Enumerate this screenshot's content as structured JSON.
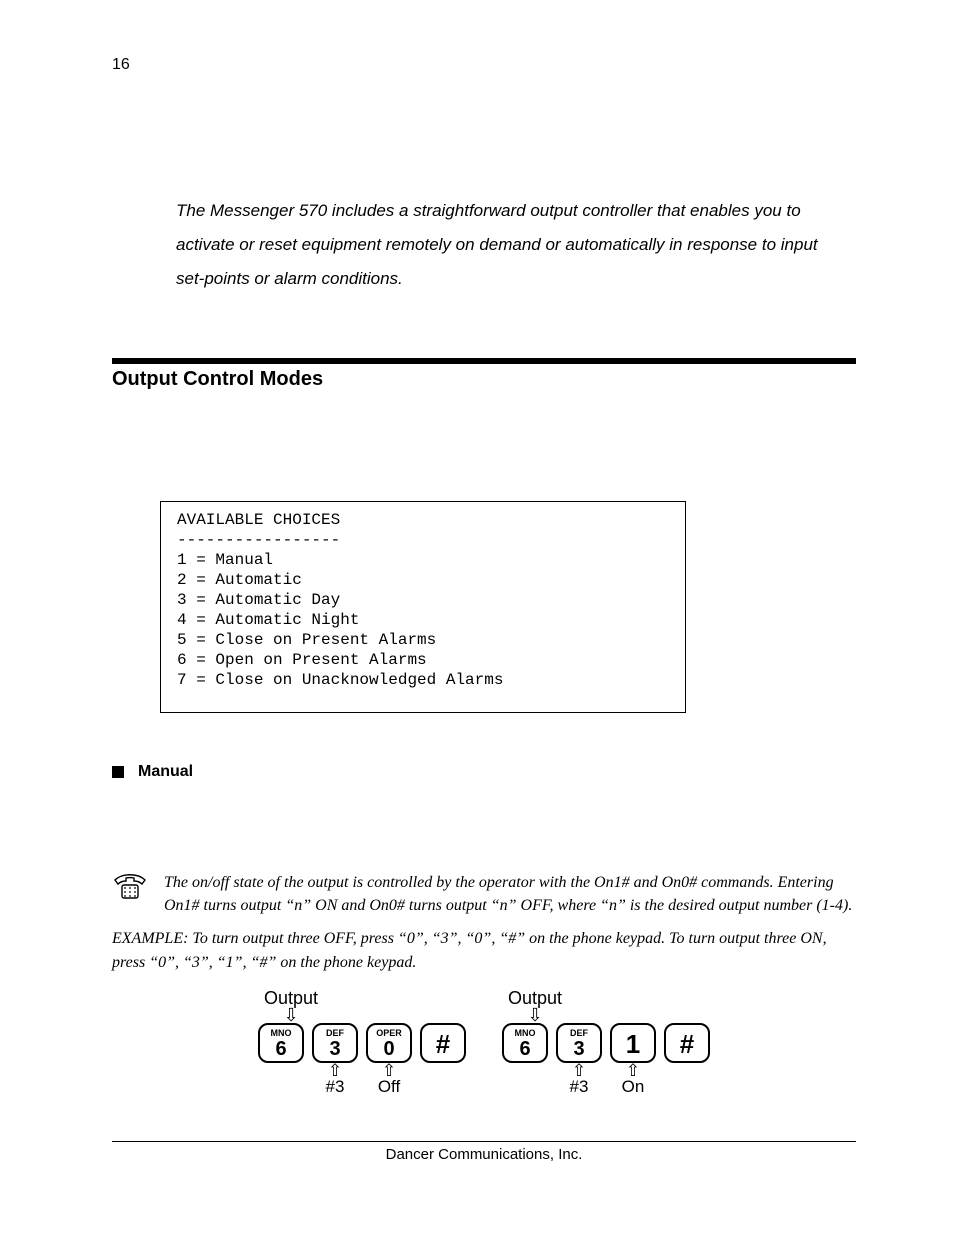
{
  "page_number": "16",
  "intro": "The Messenger 570 includes a straightforward output controller that enables you to activate or reset equipment remotely on demand or automatically in response to input set-points or alarm conditions.",
  "section_title": "Output Control Modes",
  "choices": {
    "header": "AVAILABLE CHOICES",
    "divider": "-----------------",
    "items": [
      "1 = Manual",
      "2 = Automatic",
      "3 = Automatic Day",
      "4 = Automatic Night",
      "5 = Close on Present Alarms",
      "6 = Open on Present Alarms",
      "7 = Close on Unacknowledged Alarms"
    ]
  },
  "bullet_manual": "Manual",
  "phone_para": "The on/off state of the output is controlled by the operator with the On1# and On0# commands. Entering On1# turns output “n” ON and On0# turns output “n” OFF, where “n” is the desired output number (1-4).",
  "example_para": "EXAMPLE: To turn output three OFF, press “0”, “3”, “0”, “#” on the phone keypad. To turn output three ON, press “0”, “3”, “1”, “#” on the phone keypad.",
  "keypad": {
    "top_label": "Output",
    "groups": [
      {
        "keys": [
          {
            "letters": "MNO",
            "digit": "6"
          },
          {
            "letters": "DEF",
            "digit": "3"
          },
          {
            "letters": "OPER",
            "digit": "0"
          },
          {
            "letters": "",
            "digit": "#"
          }
        ],
        "bottom": [
          "",
          "#3",
          "Off",
          ""
        ]
      },
      {
        "keys": [
          {
            "letters": "MNO",
            "digit": "6"
          },
          {
            "letters": "DEF",
            "digit": "3"
          },
          {
            "letters": "",
            "digit": "1"
          },
          {
            "letters": "",
            "digit": "#"
          }
        ],
        "bottom": [
          "",
          "#3",
          "On",
          ""
        ]
      }
    ]
  },
  "footer": "Dancer Communications, Inc."
}
